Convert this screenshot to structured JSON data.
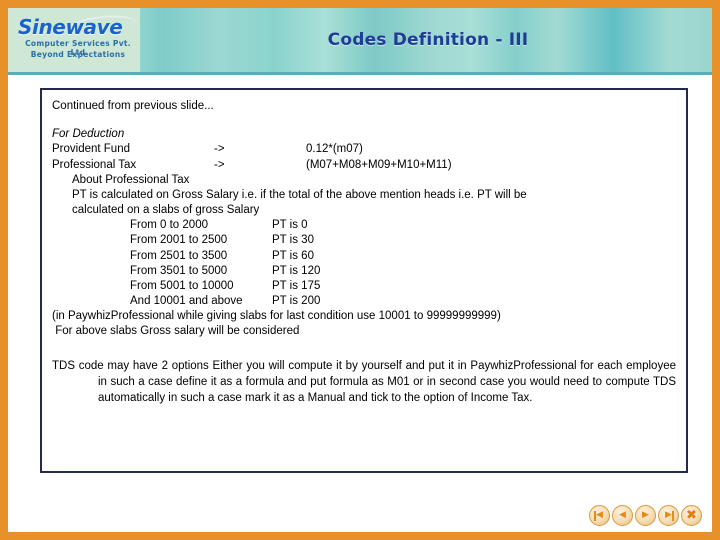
{
  "logo": {
    "wordmark": "Sinewave",
    "subtitle1": "Computer Services Pvt. Ltd",
    "subtitle2": "Beyond Expectations",
    "wordmark_color": "#1b63c8",
    "plate_color": "#cfe8d5"
  },
  "header": {
    "title": "Codes Definition - III",
    "title_color": "#1f3d96",
    "band_color": "#9bd8d2",
    "frame_color": "#e8912a"
  },
  "content": {
    "intro": "Continued from previous slide...",
    "section_heading": "For Deduction",
    "formulas": [
      {
        "name": "Provident Fund",
        "arrow": "->",
        "value": "0.12*(m07)"
      },
      {
        "name": "Professional Tax",
        "arrow": "->",
        "value": "(M07+M08+M09+M10+M11)"
      }
    ],
    "about_heading": "About Professional Tax",
    "about_line1": "PT is calculated on Gross Salary i.e. if the total of the above mention heads i.e. PT will be",
    "about_line2": "calculated on a slabs of gross Salary",
    "slabs": [
      {
        "range": "From 0 to 2000",
        "value": "PT is 0"
      },
      {
        "range": "From 2001 to 2500",
        "value": "PT is 30"
      },
      {
        "range": "From 2501 to 3500",
        "value": "PT is 60"
      },
      {
        "range": "From 3501 to 5000",
        "value": "PT is 120"
      },
      {
        "range": "From 5001 to 10000",
        "value": "PT is 175"
      },
      {
        "range": "And 10001 and above",
        "value": "PT is 200"
      }
    ],
    "note_line1": "(in PaywhizProfessional while giving slabs for last condition use 10001 to 99999999999)",
    "note_line2": " For above slabs Gross salary will be considered",
    "tds_paragraph": "TDS code may have 2 options Either you will compute it by yourself and put it in PaywhizProfessional for each employee in such a case define it as a formula and put formula as M01 or in second case you would need to compute TDS automatically in such a case mark it as a Manual and tick to the option of Income Tax."
  },
  "nav": {
    "buttons": [
      {
        "name": "first",
        "glyph": "◀"
      },
      {
        "name": "previous",
        "glyph": "◀"
      },
      {
        "name": "next",
        "glyph": "▶"
      },
      {
        "name": "last",
        "glyph": "▶"
      },
      {
        "name": "close",
        "glyph": "✖"
      }
    ]
  }
}
